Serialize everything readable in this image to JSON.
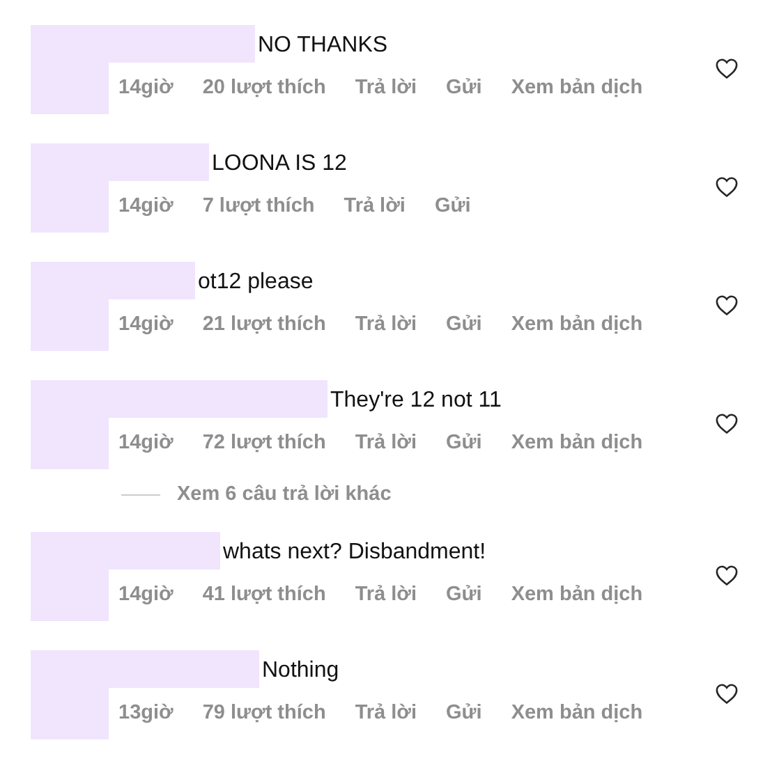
{
  "comments": [
    {
      "text": "NO THANKS",
      "meta": [
        "14giờ",
        "20 lượt thích",
        "Trả lời",
        "Gửi",
        "Xem bản dịch"
      ],
      "liked": false
    },
    {
      "text": "LOONA IS 12",
      "meta": [
        "14giờ",
        "7 lượt thích",
        "Trả lời",
        "Gửi"
      ],
      "liked": false
    },
    {
      "text": "ot12 please",
      "meta": [
        "14giờ",
        "21 lượt thích",
        "Trả lời",
        "Gửi",
        "Xem bản dịch"
      ],
      "liked": false
    },
    {
      "text": "They're 12 not 11",
      "meta": [
        "14giờ",
        "72 lượt thích",
        "Trả lời",
        "Gửi",
        "Xem bản dịch"
      ],
      "liked": false,
      "more_replies": "Xem 6 câu trả lời khác"
    },
    {
      "text": "whats next? Disbandment!",
      "meta": [
        "14giờ",
        "41 lượt thích",
        "Trả lời",
        "Gửi",
        "Xem bản dịch"
      ],
      "liked": false
    },
    {
      "text": "Nothing",
      "meta": [
        "13giờ",
        "79 lượt thích",
        "Trả lời",
        "Gửi",
        "Xem bản dịch"
      ],
      "liked": false
    }
  ]
}
